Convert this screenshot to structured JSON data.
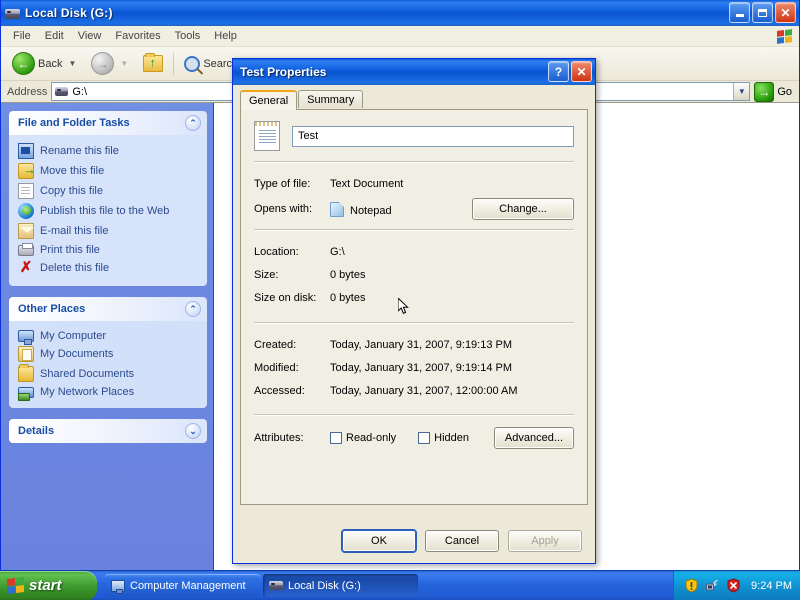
{
  "explorer": {
    "title": "Local Disk (G:)",
    "title_icon": "hard-disk-icon",
    "window_controls": {
      "minimize": "_",
      "maximize": "❐",
      "close": "✕"
    },
    "menu": [
      "File",
      "Edit",
      "View",
      "Favorites",
      "Tools",
      "Help"
    ],
    "toolbar": {
      "back_label": "Back",
      "forward_label": "",
      "up_label": "",
      "search_label": "Search"
    },
    "address": {
      "label": "Address",
      "value": "G:\\",
      "go_label": "Go"
    },
    "statusbar": ""
  },
  "sidebar": {
    "panels": [
      {
        "title": "File and Folder Tasks",
        "collapse_glyph": "⌃",
        "items": [
          {
            "label": "Rename this file",
            "icon": "rename-icon"
          },
          {
            "label": "Move this file",
            "icon": "move-icon"
          },
          {
            "label": "Copy this file",
            "icon": "copy-icon"
          },
          {
            "label": "Publish this file to the Web",
            "icon": "publish-web-icon"
          },
          {
            "label": "E-mail this file",
            "icon": "email-icon"
          },
          {
            "label": "Print this file",
            "icon": "print-icon"
          },
          {
            "label": "Delete this file",
            "icon": "delete-icon"
          }
        ]
      },
      {
        "title": "Other Places",
        "collapse_glyph": "⌃",
        "items": [
          {
            "label": "My Computer",
            "icon": "my-computer-icon"
          },
          {
            "label": "My Documents",
            "icon": "my-documents-icon"
          },
          {
            "label": "Shared Documents",
            "icon": "shared-documents-icon"
          },
          {
            "label": "My Network Places",
            "icon": "network-places-icon"
          }
        ]
      },
      {
        "title": "Details",
        "collapse_glyph": "⌄",
        "items": []
      }
    ]
  },
  "dialog": {
    "title": "Test Properties",
    "help_glyph": "?",
    "close_glyph": "✕",
    "tabs": [
      {
        "label": "General",
        "active": true
      },
      {
        "label": "Summary",
        "active": false
      }
    ],
    "file_name": "Test",
    "file_icon": "text-document-icon",
    "fields": [
      {
        "key": "Type of file:",
        "value": "Text Document"
      },
      {
        "key": "Opens with:",
        "value": "Notepad",
        "icon": "notepad-icon",
        "button": "Change..."
      },
      {
        "key": "Location:",
        "value": "G:\\"
      },
      {
        "key": "Size:",
        "value": "0 bytes"
      },
      {
        "key": "Size on disk:",
        "value": "0 bytes"
      },
      {
        "key": "Created:",
        "value": "Today, January 31, 2007, 9:19:13 PM"
      },
      {
        "key": "Modified:",
        "value": "Today, January 31, 2007, 9:19:14 PM"
      },
      {
        "key": "Accessed:",
        "value": "Today, January 31, 2007, 12:00:00 AM"
      }
    ],
    "attributes": {
      "label": "Attributes:",
      "readonly_label": "Read-only",
      "readonly_checked": false,
      "hidden_label": "Hidden",
      "hidden_checked": false,
      "advanced_label": "Advanced..."
    },
    "change_button": "Change...",
    "footer": {
      "ok": "OK",
      "cancel": "Cancel",
      "apply": "Apply",
      "apply_disabled": true
    }
  },
  "taskbar": {
    "start_label": "start",
    "buttons": [
      {
        "label": "Computer Management",
        "icon": "computer-management-icon",
        "active": false
      },
      {
        "label": "Local Disk (G:)",
        "icon": "hard-disk-icon",
        "active": true
      }
    ],
    "tray": {
      "icons": [
        "security-alert-shield-icon",
        "network-activity-icon",
        "antivirus-shield-icon"
      ],
      "time": "9:24 PM"
    }
  },
  "colors": {
    "title_blue": "#0a54cf",
    "sidebar_blue": "#6d8ce1",
    "panel_body": "#d7e3fb",
    "dialog_face": "#ece9d8",
    "taskbar_blue": "#2765dd",
    "start_green": "#3e9a2e",
    "tab_accent": "#f0a818"
  }
}
